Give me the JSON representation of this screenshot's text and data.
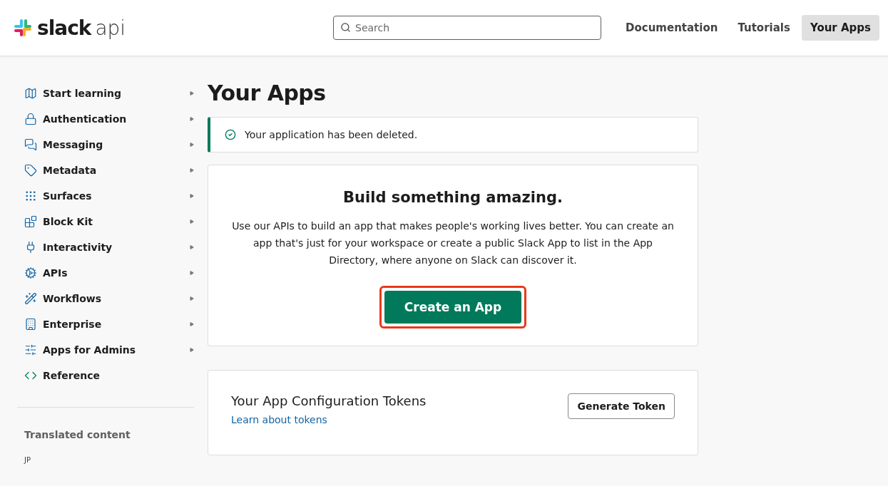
{
  "header": {
    "logo": {
      "word": "slack",
      "suffix": "api"
    },
    "search": {
      "placeholder": "Search"
    },
    "nav": [
      {
        "label": "Documentation",
        "selected": false
      },
      {
        "label": "Tutorials",
        "selected": false
      },
      {
        "label": "Your Apps",
        "selected": true
      }
    ]
  },
  "sidebar": {
    "items": [
      {
        "label": "Start learning",
        "expandable": true
      },
      {
        "label": "Authentication",
        "expandable": true
      },
      {
        "label": "Messaging",
        "expandable": true
      },
      {
        "label": "Metadata",
        "expandable": true
      },
      {
        "label": "Surfaces",
        "expandable": true
      },
      {
        "label": "Block Kit",
        "expandable": true
      },
      {
        "label": "Interactivity",
        "expandable": true
      },
      {
        "label": "APIs",
        "expandable": true
      },
      {
        "label": "Workflows",
        "expandable": true
      },
      {
        "label": "Enterprise",
        "expandable": true
      },
      {
        "label": "Apps for Admins",
        "expandable": true
      },
      {
        "label": "Reference",
        "expandable": false
      }
    ],
    "translated": {
      "heading": "Translated content",
      "links": [
        "JP"
      ]
    }
  },
  "main": {
    "title": "Your Apps",
    "alert": {
      "text": "Your application has been deleted."
    },
    "intro_card": {
      "heading": "Build something amazing.",
      "body": "Use our APIs to build an app that makes people's working lives better. You can create an app that's just for your workspace or create a public Slack App to list in the App Directory, where anyone on Slack can discover it.",
      "button": {
        "label": "Create an App",
        "highlighted": true
      }
    },
    "tokens_card": {
      "heading": "Your App Configuration Tokens",
      "link": "Learn about tokens",
      "button": "Generate Token"
    }
  }
}
